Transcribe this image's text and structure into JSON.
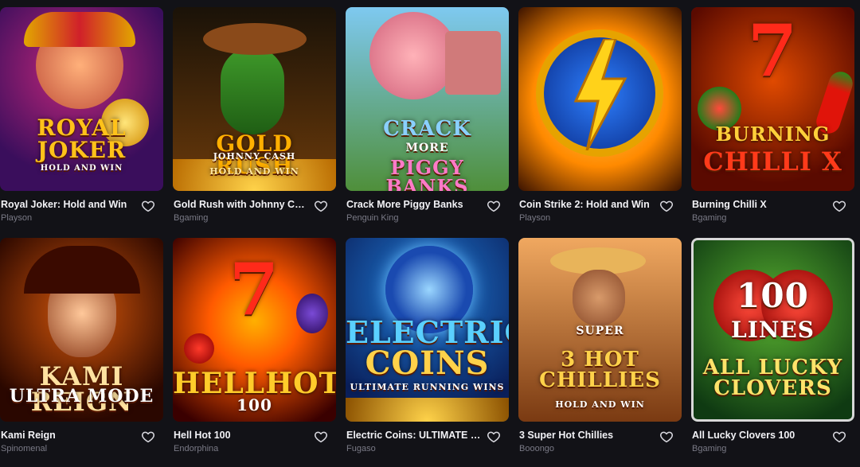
{
  "games": [
    {
      "title": "Royal Joker: Hold and Win",
      "provider": "Playson",
      "logo": [
        "ROYAL",
        "JOKER",
        "HOLD AND WIN"
      ],
      "bg": [
        "#3a0e5c",
        "#c0267a"
      ],
      "accent": "#ffc21a"
    },
    {
      "title": "Gold Rush with Johnny Cash",
      "provider": "Bgaming",
      "logo": [
        "GOLD RUSH",
        "JOHNNY CASH",
        "HOLD AND WIN"
      ],
      "bg": [
        "#1a1208",
        "#6b3a0a"
      ],
      "accent": "#ffb000"
    },
    {
      "title": "Crack More Piggy Banks",
      "provider": "Penguin King",
      "logo": [
        "CRACK",
        "MORE",
        "PIGGY BANKS"
      ],
      "bg": [
        "#7ec9f0",
        "#4f8f3a"
      ],
      "accent": "#ff6fb5"
    },
    {
      "title": "Coin Strike 2: Hold and Win",
      "provider": "Playson",
      "logo": [
        "",
        "",
        ""
      ],
      "bg": [
        "#0d3fae",
        "#ff9a00"
      ],
      "accent": "#ffd000"
    },
    {
      "title": "Burning Chilli X",
      "provider": "Bgaming",
      "logo": [
        "7",
        "BURNING",
        "CHILLI X"
      ],
      "bg": [
        "#5a0a00",
        "#e04a00"
      ],
      "accent": "#ff2a1a"
    },
    {
      "title": "Kami Reign",
      "provider": "Spinomenal",
      "logo": [
        "KAMI REIGN",
        "ULTRA MODE",
        ""
      ],
      "bg": [
        "#2a0700",
        "#d6570a"
      ],
      "accent": "#ffd88a"
    },
    {
      "title": "Hell Hot 100",
      "provider": "Endorphina",
      "logo": [
        "7",
        "HELLHOT",
        "100"
      ],
      "bg": [
        "#3a0000",
        "#ff5a00"
      ],
      "accent": "#ffb300"
    },
    {
      "title": "Electric Coins: ULTIMATE RUNN...",
      "provider": "Fugaso",
      "logo": [
        "ELECTRIC",
        "COINS",
        "ULTIMATE  RUNNING WINS"
      ],
      "bg": [
        "#0a1f5a",
        "#1f7ad6"
      ],
      "accent": "#ffd24a"
    },
    {
      "title": "3 Super Hot Chillies",
      "provider": "Booongo",
      "logo": [
        "SUPER",
        "3 HOT CHILLIES",
        "HOLD AND WIN"
      ],
      "bg": [
        "#f0a860",
        "#7a3a12"
      ],
      "accent": "#ff3a1a"
    },
    {
      "title": "All Lucky Clovers 100",
      "provider": "Bgaming",
      "logo": [
        "100",
        "LINES",
        "ALL LUCKY CLOVERS"
      ],
      "bg": [
        "#0f3a12",
        "#58b030"
      ],
      "accent": "#ffe36a"
    }
  ],
  "icons": {
    "favorite": "heart-outline-icon"
  }
}
